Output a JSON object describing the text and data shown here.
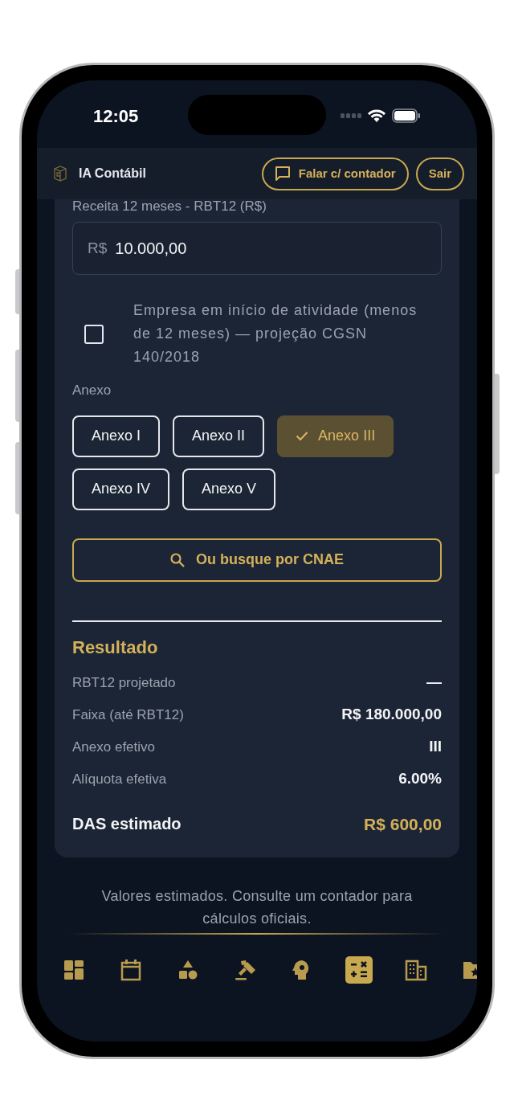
{
  "status_bar": {
    "time": "12:05"
  },
  "header": {
    "title": "IA Contábil",
    "buttons": [
      {
        "label": "Falar c/ contador",
        "kind": "chat"
      },
      {
        "label": "Sair",
        "kind": "plain"
      }
    ]
  },
  "form": {
    "revenue_label": "Receita 12 meses - RBT12 (R$)",
    "revenue_prefix": "R$",
    "revenue_value": "10.000,00",
    "startup_checkbox": {
      "label": "Empresa em início de atividade (menos de 12 meses) — projeção CGSN 140/2018",
      "checked": false
    },
    "annex_label": "Anexo",
    "annexes": [
      {
        "label": "Anexo I",
        "selected": false
      },
      {
        "label": "Anexo II",
        "selected": false
      },
      {
        "label": "Anexo III",
        "selected": true
      },
      {
        "label": "Anexo IV",
        "selected": false
      },
      {
        "label": "Anexo V",
        "selected": false
      }
    ],
    "cnae_button": "Ou busque por CNAE"
  },
  "result": {
    "title": "Resultado",
    "rows": [
      {
        "label": "RBT12 projetado",
        "value": "—"
      },
      {
        "label": "Faixa (até RBT12)",
        "value": "R$ 180.000,00"
      },
      {
        "label": "Anexo efetivo",
        "value": "III"
      },
      {
        "label": "Alíquota efetiva",
        "value": "6.00%"
      }
    ],
    "total": {
      "label": "DAS estimado",
      "value": "R$ 600,00"
    }
  },
  "footer_note": "Valores estimados. Consulte um contador para cálculos oficiais.",
  "bottom_nav": [
    {
      "kind": "dashboard",
      "selected": false
    },
    {
      "kind": "calendar",
      "selected": false
    },
    {
      "kind": "shapes",
      "selected": false
    },
    {
      "kind": "gavel",
      "selected": false
    },
    {
      "kind": "head",
      "selected": false
    },
    {
      "kind": "calculator",
      "selected": true
    },
    {
      "kind": "building",
      "selected": false
    },
    {
      "kind": "folder",
      "selected": false
    }
  ]
}
